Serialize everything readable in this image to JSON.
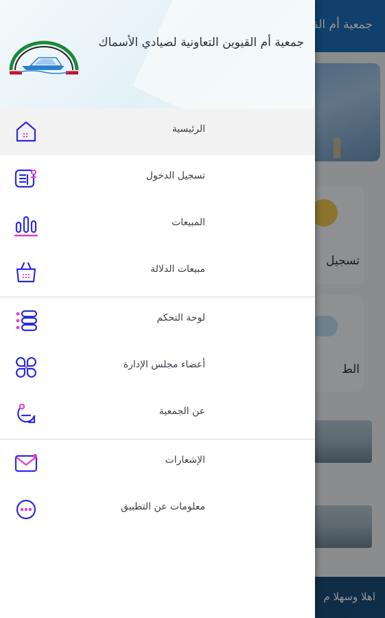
{
  "background": {
    "topbar_title": "جمعية أم القيوين",
    "card_1_label": "تسجيل",
    "card_2_label": "الط",
    "footer_text": "اهلا وسهلا م"
  },
  "drawer": {
    "title": "جمعية أم القيوين التعاونية لصيادي الأسماك",
    "logo_icon": "association-boat-logo",
    "items": [
      {
        "label": "الرئيسية",
        "icon": "home-icon",
        "active": true
      },
      {
        "label": "تسجيل الدخول",
        "icon": "login-icon"
      },
      {
        "label": "المبيعات",
        "icon": "sales-chart-icon"
      },
      {
        "label": "مبيعات الدلالة",
        "icon": "auction-bag-icon"
      },
      {
        "label": "لوحة التحكم",
        "icon": "dashboard-list-icon"
      },
      {
        "label": "أعضاء مجلس الإدارة",
        "icon": "board-members-icon"
      },
      {
        "label": "عن الجمعية",
        "icon": "about-chat-icon"
      },
      {
        "label": "الإشعارات",
        "icon": "notifications-mail-icon"
      },
      {
        "label": "معلومات عن التطبيق",
        "icon": "app-info-dots-icon"
      }
    ]
  },
  "colors": {
    "icon_blue": "#2b2be0",
    "icon_pink": "#e23bd6",
    "topbar": "#1c6fb8",
    "active_row": "#f2f2f2"
  }
}
